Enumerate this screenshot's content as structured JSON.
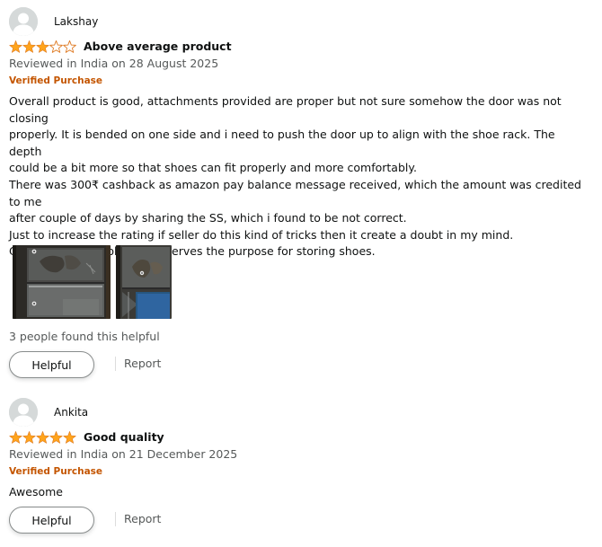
{
  "reviews": [
    {
      "profile_name": "Lakshay",
      "rating": 3,
      "rating_max": 5,
      "title": "Above average product",
      "date_line": "Reviewed in India on 28 August 2025",
      "verified_label": "Verified Purchase",
      "body": [
        "Overall product is good, attachments provided are proper but not sure somehow the door was not closing",
        "properly. It is bended on one side and i need to push the door up to align with the shoe rack. The depth",
        "could be a bit more so that shoes can fit properly and more comfortably.",
        "There was 300₹ cashback as amazon pay balance message received, which the amount was credited to me",
        "after couple of days by sharing the SS, which i found to be not correct.",
        "Just to increase the rating if seller do this kind of tricks then it create a doubt in my mind.",
        "",
        "Overall quality is ok ok and serves the purpose for storing shoes."
      ],
      "images": [
        "review-photo-shoe-rack-1",
        "review-photo-shoe-rack-2"
      ],
      "helpful_count_text": "3 people found this helpful",
      "helpful_label": "Helpful",
      "report_label": "Report"
    },
    {
      "profile_name": "Ankita",
      "rating": 5,
      "rating_max": 5,
      "title": "Good quality",
      "date_line": "Reviewed in India on 21 December 2025",
      "verified_label": "Verified Purchase",
      "body": [
        "Awesome"
      ],
      "helpful_label": "Helpful",
      "report_label": "Report"
    }
  ],
  "colors": {
    "star_fill": "#ffa41c",
    "star_outline": "#de7921",
    "verified": "#c45500",
    "secondary_text": "#565959",
    "primary_text": "#0f1111"
  },
  "icons": {
    "avatar": "default-user-avatar-icon",
    "star_full": "star-filled-icon",
    "star_empty": "star-outline-icon"
  }
}
